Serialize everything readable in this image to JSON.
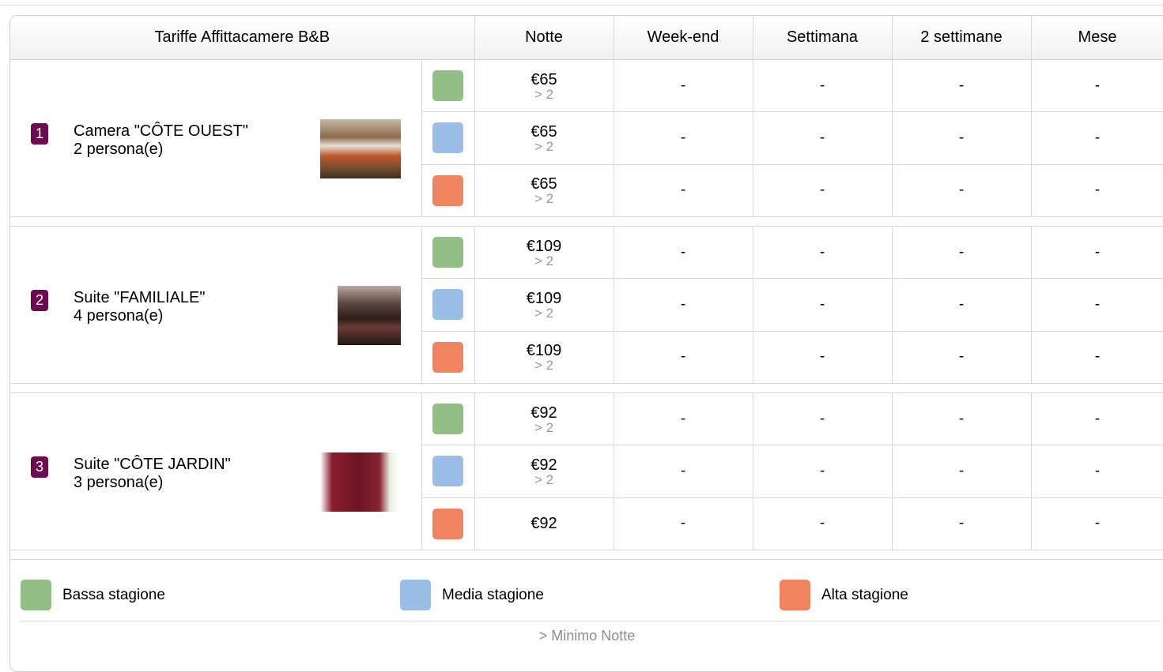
{
  "colors": {
    "low": "#93bf86",
    "mid": "#9bbee8",
    "high": "#f08460",
    "badge": "#6d0b4e"
  },
  "header": {
    "title": "Tariffe Affittacamere B&B",
    "night": "Notte",
    "weekend": "Week-end",
    "week": "Settimana",
    "two_weeks": "2 settimane",
    "month": "Mese"
  },
  "rooms": [
    {
      "num": "1",
      "name": "Camera \"CÔTE OUEST\"",
      "capacity": "2 persona(e)",
      "rates": [
        {
          "price": "€65",
          "min": "> 2",
          "weekend": "-",
          "week": "-",
          "two_weeks": "-",
          "month": "-"
        },
        {
          "price": "€65",
          "min": "> 2",
          "weekend": "-",
          "week": "-",
          "two_weeks": "-",
          "month": "-"
        },
        {
          "price": "€65",
          "min": "> 2",
          "weekend": "-",
          "week": "-",
          "two_weeks": "-",
          "month": "-"
        }
      ]
    },
    {
      "num": "2",
      "name": "Suite \"FAMILIALE\"",
      "capacity": "4 persona(e)",
      "rates": [
        {
          "price": "€109",
          "min": "> 2",
          "weekend": "-",
          "week": "-",
          "two_weeks": "-",
          "month": "-"
        },
        {
          "price": "€109",
          "min": "> 2",
          "weekend": "-",
          "week": "-",
          "two_weeks": "-",
          "month": "-"
        },
        {
          "price": "€109",
          "min": "> 2",
          "weekend": "-",
          "week": "-",
          "two_weeks": "-",
          "month": "-"
        }
      ]
    },
    {
      "num": "3",
      "name": "Suite \"CÔTE JARDIN\"",
      "capacity": "3 persona(e)",
      "rates": [
        {
          "price": "€92",
          "min": "> 2",
          "weekend": "-",
          "week": "-",
          "two_weeks": "-",
          "month": "-"
        },
        {
          "price": "€92",
          "min": "> 2",
          "weekend": "-",
          "week": "-",
          "two_weeks": "-",
          "month": "-"
        },
        {
          "price": "€92",
          "min": "",
          "weekend": "-",
          "week": "-",
          "two_weeks": "-",
          "month": "-"
        }
      ]
    }
  ],
  "legend": {
    "low": "Bassa stagione",
    "mid": "Media stagione",
    "high": "Alta stagione"
  },
  "footnote": "> Minimo Notte"
}
